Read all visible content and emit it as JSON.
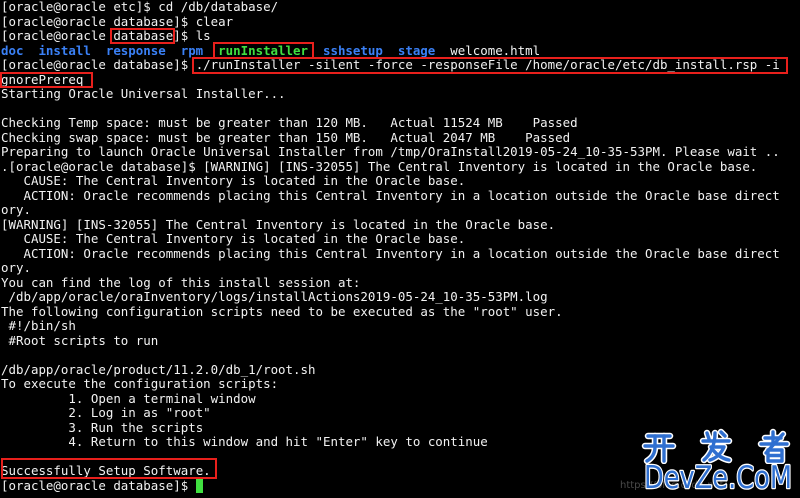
{
  "colors": {
    "background": "#000000",
    "text": "#f2f2f2",
    "directory": "#3a80f6",
    "executable": "#40e040",
    "cursor": "#40e040",
    "annotation": "#e8201c",
    "watermark": "#2f6fd0",
    "watermark_outline": "#ffffff"
  },
  "terminal": {
    "history": [
      "[oracle@oracle etc]$ cd /db/database/",
      "[oracle@oracle database]$ clear",
      "[oracle@oracle database]$ ls"
    ],
    "ls_output": [
      "doc",
      "install",
      "response",
      "rpm",
      "runInstaller",
      "sshsetup",
      "stage",
      "welcome.html"
    ],
    "session_output": [
      "[oracle@oracle database]$ ./runInstaller -silent -force -responseFile /home/oracle/etc/db_install.rsp -i",
      "gnorePrereq",
      "Starting Oracle Universal Installer...",
      "",
      "Checking Temp space: must be greater than 120 MB.   Actual 11524 MB    Passed",
      "Checking swap space: must be greater than 150 MB.   Actual 2047 MB    Passed",
      "Preparing to launch Oracle Universal Installer from /tmp/OraInstall2019-05-24_10-35-53PM. Please wait ..",
      ".[oracle@oracle database]$ [WARNING] [INS-32055] The Central Inventory is located in the Oracle base.",
      "   CAUSE: The Central Inventory is located in the Oracle base.",
      "   ACTION: Oracle recommends placing this Central Inventory in a location outside the Oracle base direct",
      "ory.",
      "[WARNING] [INS-32055] The Central Inventory is located in the Oracle base.",
      "   CAUSE: The Central Inventory is located in the Oracle base.",
      "   ACTION: Oracle recommends placing this Central Inventory in a location outside the Oracle base direct",
      "ory.",
      "You can find the log of this install session at:",
      " /db/app/oracle/oraInventory/logs/installActions2019-05-24_10-35-53PM.log",
      "The following configuration scripts need to be executed as the \"root\" user.",
      " #!/bin/sh",
      " #Root scripts to run",
      "",
      "/db/app/oracle/product/11.2.0/db_1/root.sh",
      "To execute the configuration scripts:",
      "         1. Open a terminal window",
      "         2. Log in as \"root\"",
      "         3. Run the scripts",
      "         4. Return to this window and hit \"Enter\" key to continue",
      "",
      "Successfully Setup Software."
    ],
    "prompt": "[oracle@oracle database]$ "
  },
  "watermark": {
    "logo_cn": "开 发 者",
    "logo_en": "DevZe.CoM",
    "source_url": "https://blog.csdn.net/"
  }
}
